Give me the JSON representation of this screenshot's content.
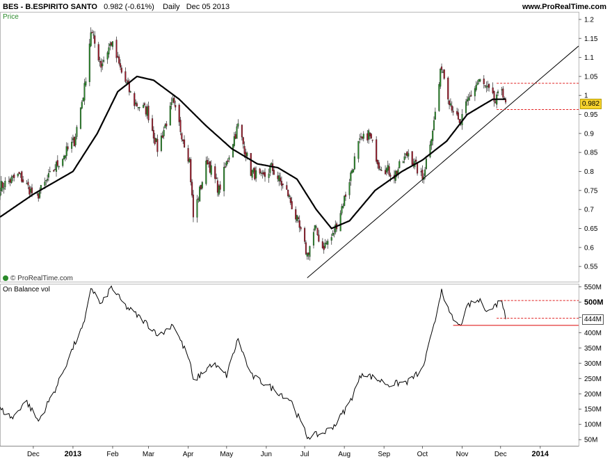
{
  "header": {
    "symbol": "BES - B.ESPIRITO SANTO",
    "quote": "0.982 (-0.61%)",
    "period": "Daily",
    "date": "Dec 05 2013",
    "site": "www.ProRealTime.com"
  },
  "panels": {
    "price_label": "Price",
    "obv_label": "On Balance vol",
    "credit": "© ProRealTime.com"
  },
  "tags": {
    "price_current": "0.982",
    "obv_current": "444M"
  },
  "colors": {
    "up": "#2a8a2a",
    "down": "#9a1a2a",
    "ma": "#000000",
    "trendline": "#000000",
    "dashed_level": "#e02020",
    "obv_line": "#000000",
    "support_line": "#e02020",
    "price_tag": "#f7d32e"
  },
  "chart_data": [
    {
      "type": "candlestick",
      "title": "Price",
      "x_ticks": [
        "Dec",
        "2013",
        "Feb",
        "Mar",
        "Apr",
        "May",
        "Jun",
        "Jul",
        "Aug",
        "Sep",
        "Oct",
        "Nov",
        "Dec",
        "2014"
      ],
      "y_ticks": [
        "1.2",
        "1.15",
        "1.1",
        "1.05",
        "1",
        "0.95",
        "0.9",
        "0.85",
        "0.8",
        "0.75",
        "0.7",
        "0.65",
        "0.6",
        "0.55"
      ],
      "ylim": [
        0.51,
        1.22
      ],
      "xlim": [
        "2012-11-05",
        "2014-01-31"
      ],
      "close_anchors": [
        [
          "2012-11-05",
          0.76
        ],
        [
          "2012-11-20",
          0.79
        ],
        [
          "2012-12-03",
          0.73
        ],
        [
          "2012-12-20",
          0.82
        ],
        [
          "2013-01-02",
          0.88
        ],
        [
          "2013-01-10",
          1.02
        ],
        [
          "2013-01-15",
          1.17
        ],
        [
          "2013-01-23",
          1.08
        ],
        [
          "2013-01-31",
          1.14
        ],
        [
          "2013-02-08",
          1.06
        ],
        [
          "2013-02-18",
          0.98
        ],
        [
          "2013-02-28",
          0.96
        ],
        [
          "2013-03-08",
          0.86
        ],
        [
          "2013-03-20",
          0.98
        ],
        [
          "2013-04-02",
          0.83
        ],
        [
          "2013-04-05",
          0.68
        ],
        [
          "2013-04-16",
          0.83
        ],
        [
          "2013-04-25",
          0.75
        ],
        [
          "2013-05-06",
          0.88
        ],
        [
          "2013-05-10",
          0.92
        ],
        [
          "2013-05-20",
          0.8
        ],
        [
          "2013-05-29",
          0.78
        ],
        [
          "2013-06-05",
          0.81
        ],
        [
          "2013-06-18",
          0.74
        ],
        [
          "2013-06-26",
          0.66
        ],
        [
          "2013-07-03",
          0.58
        ],
        [
          "2013-07-09",
          0.65
        ],
        [
          "2013-07-15",
          0.6
        ],
        [
          "2013-07-23",
          0.63
        ],
        [
          "2013-08-02",
          0.74
        ],
        [
          "2013-08-12",
          0.87
        ],
        [
          "2013-08-20",
          0.9
        ],
        [
          "2013-08-28",
          0.82
        ],
        [
          "2013-09-09",
          0.79
        ],
        [
          "2013-09-20",
          0.85
        ],
        [
          "2013-10-01",
          0.78
        ],
        [
          "2013-10-10",
          0.93
        ],
        [
          "2013-10-16",
          1.08
        ],
        [
          "2013-10-22",
          0.99
        ],
        [
          "2013-10-30",
          0.92
        ],
        [
          "2013-11-06",
          0.99
        ],
        [
          "2013-11-14",
          1.04
        ],
        [
          "2013-11-22",
          1.01
        ],
        [
          "2013-11-27",
          0.98
        ],
        [
          "2013-12-02",
          1.02
        ],
        [
          "2013-12-05",
          0.982
        ]
      ],
      "moving_average_anchors": [
        [
          "2012-11-05",
          0.68
        ],
        [
          "2012-12-01",
          0.74
        ],
        [
          "2013-01-01",
          0.8
        ],
        [
          "2013-01-20",
          0.9
        ],
        [
          "2013-02-05",
          1.01
        ],
        [
          "2013-02-20",
          1.05
        ],
        [
          "2013-03-05",
          1.04
        ],
        [
          "2013-03-25",
          0.99
        ],
        [
          "2013-04-15",
          0.92
        ],
        [
          "2013-05-05",
          0.86
        ],
        [
          "2013-05-25",
          0.82
        ],
        [
          "2013-06-10",
          0.81
        ],
        [
          "2013-06-25",
          0.78
        ],
        [
          "2013-07-10",
          0.7
        ],
        [
          "2013-07-22",
          0.65
        ],
        [
          "2013-08-05",
          0.67
        ],
        [
          "2013-08-25",
          0.75
        ],
        [
          "2013-09-15",
          0.8
        ],
        [
          "2013-10-01",
          0.83
        ],
        [
          "2013-10-20",
          0.88
        ],
        [
          "2013-11-05",
          0.95
        ],
        [
          "2013-11-25",
          0.99
        ],
        [
          "2013-12-05",
          0.99
        ]
      ],
      "trendline": [
        [
          "2013-07-03",
          0.52
        ],
        [
          "2014-01-31",
          1.13
        ]
      ],
      "resistance_level": 1.032,
      "support_level": 0.963
    },
    {
      "type": "line",
      "title": "On Balance vol",
      "y_ticks": [
        "550M",
        "500M",
        "450M",
        "400M",
        "350M",
        "300M",
        "250M",
        "200M",
        "150M",
        "100M",
        "50M"
      ],
      "ylim": [
        30,
        560
      ],
      "unit": "M",
      "obv_anchors": [
        [
          "2012-11-05",
          150
        ],
        [
          "2012-11-15",
          120
        ],
        [
          "2012-11-25",
          180
        ],
        [
          "2012-12-05",
          110
        ],
        [
          "2012-12-20",
          230
        ],
        [
          "2013-01-02",
          360
        ],
        [
          "2013-01-10",
          430
        ],
        [
          "2013-01-15",
          550
        ],
        [
          "2013-01-23",
          490
        ],
        [
          "2013-01-31",
          550
        ],
        [
          "2013-02-10",
          490
        ],
        [
          "2013-02-25",
          440
        ],
        [
          "2013-03-10",
          390
        ],
        [
          "2013-03-20",
          430
        ],
        [
          "2013-04-02",
          310
        ],
        [
          "2013-04-05",
          240
        ],
        [
          "2013-04-20",
          300
        ],
        [
          "2013-05-01",
          260
        ],
        [
          "2013-05-10",
          380
        ],
        [
          "2013-05-20",
          260
        ],
        [
          "2013-06-05",
          220
        ],
        [
          "2013-06-20",
          180
        ],
        [
          "2013-07-03",
          60
        ],
        [
          "2013-07-15",
          70
        ],
        [
          "2013-07-25",
          100
        ],
        [
          "2013-08-05",
          170
        ],
        [
          "2013-08-15",
          270
        ],
        [
          "2013-08-25",
          250
        ],
        [
          "2013-09-05",
          230
        ],
        [
          "2013-09-20",
          240
        ],
        [
          "2013-10-01",
          280
        ],
        [
          "2013-10-10",
          420
        ],
        [
          "2013-10-16",
          545
        ],
        [
          "2013-10-22",
          460
        ],
        [
          "2013-10-30",
          420
        ],
        [
          "2013-11-06",
          490
        ],
        [
          "2013-11-14",
          505
        ],
        [
          "2013-11-22",
          470
        ],
        [
          "2013-12-02",
          510
        ],
        [
          "2013-12-05",
          444
        ]
      ],
      "resistance_level": 505,
      "mid_level": 447,
      "support_level": 424
    }
  ]
}
